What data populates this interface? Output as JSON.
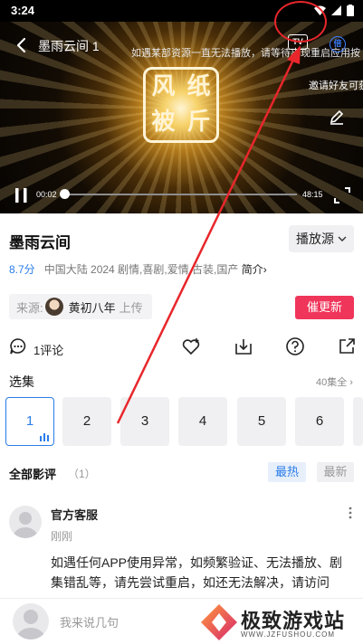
{
  "status_bar": {
    "time": "3:24"
  },
  "player": {
    "title": "墨雨云间 1",
    "marquee": "如遇某部资源一直无法播放，请等待出现重启应用按",
    "tv_label": "TV",
    "speed_label": "倍",
    "invite": "邀请好友可获",
    "logo_chars": [
      "风",
      "纸",
      "被",
      "斤"
    ],
    "current_time": "00:02",
    "duration": "48:15",
    "progress": 0.004
  },
  "video": {
    "title": "墨雨云间",
    "source_button": "播放源",
    "score": "8.7分",
    "meta": "中国大陆  2024  剧情,喜剧,爱情,古装,国产",
    "intro_link": "简介",
    "source_prefix": "来源:",
    "uploader": "黄初八年",
    "upload_suffix": "上传",
    "urge_button": "催更新"
  },
  "actions": {
    "comment_count": "1评论"
  },
  "episodes": {
    "title": "选集",
    "count": "40集全",
    "items": [
      "1",
      "2",
      "3",
      "4",
      "5",
      "6"
    ],
    "active_index": 0
  },
  "reviews": {
    "title": "全部影评",
    "count": "（1）",
    "tab_hot": "最热",
    "tab_new": "最新",
    "comment": {
      "user": "官方客服",
      "time": "刚刚",
      "body": "如遇任何APP使用异常，如频繁验证、无法播放、剧集错乱等，请先尝试重启，如还无法解决，请访问"
    }
  },
  "bottom_bar": {
    "input_placeholder": "我来说几句"
  },
  "watermark": {
    "text": "极致游戏站",
    "url": "WWW.JZFUSHOU.COM"
  },
  "colors": {
    "accent": "#2b7de9",
    "urge": "#f0355a",
    "annotation": "#e8262b"
  }
}
